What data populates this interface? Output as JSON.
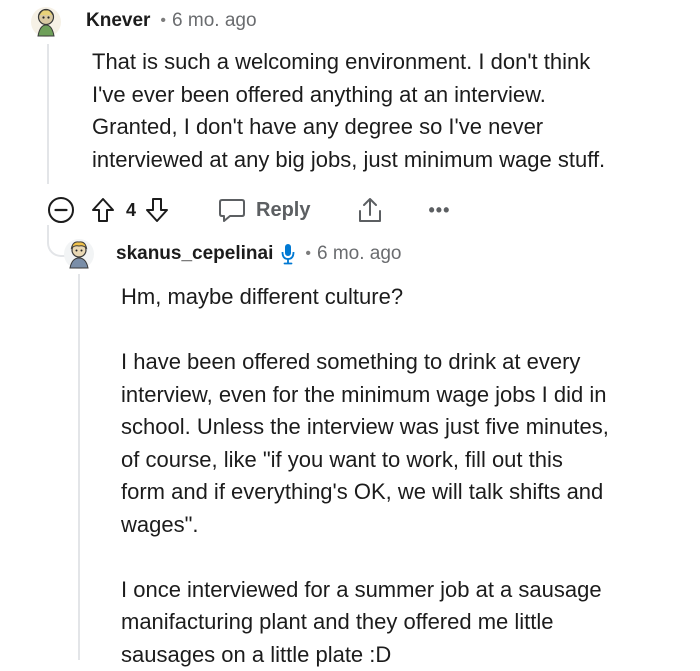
{
  "comment": {
    "username": "Knever",
    "separator": "•",
    "timestamp": "6 mo. ago",
    "avatar_icon": "avatar-icon",
    "body_lines": [
      "That is such a welcoming environment. I don't think",
      "I've ever been offered anything at an interview.",
      "Granted, I don't have any degree so I've never",
      "interviewed at any big jobs, just minimum wage stuff."
    ],
    "actions": {
      "collapse_icon": "minus-circle-icon",
      "upvote_icon": "arrow-up-icon",
      "vote_count": "4",
      "downvote_icon": "arrow-down-icon",
      "reply_icon": "chat-bubble-icon",
      "reply_label": "Reply",
      "share_icon": "share-icon",
      "more_label": "•••"
    }
  },
  "reply": {
    "username": "skanus_cepelinai",
    "mic_icon": "microphone-icon",
    "separator": "•",
    "timestamp": "6 mo. ago",
    "avatar_icon": "avatar-icon",
    "paragraphs": [
      {
        "lines": [
          "Hm, maybe different culture?"
        ]
      },
      {
        "lines": [
          "I have been offered something to drink at every",
          "interview, even for the minimum wage jobs I did in",
          "school. Unless the interview was just five minutes,",
          "of course, like \"if you want to work, fill out this",
          "form and if everything's OK, we will talk shifts and",
          "wages\"."
        ]
      },
      {
        "lines": [
          "I once interviewed for a summer job at a sausage",
          "manifacturing plant and they offered me little",
          "sausages on a little plate :D"
        ]
      }
    ]
  },
  "colors": {
    "text": "#1c1c1c",
    "muted": "#6a6c6f",
    "thread_line": "#e3e5e8",
    "mic_blue": "#0079d3"
  }
}
